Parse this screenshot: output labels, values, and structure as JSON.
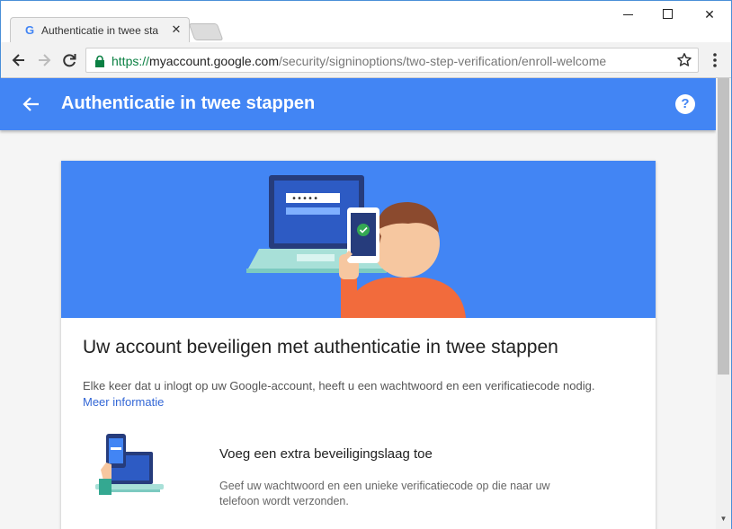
{
  "browser": {
    "tab_title": "Authenticatie in twee sta",
    "tab_favicon": "G",
    "close_glyph": "✕",
    "url_scheme": "https://",
    "url_host": "myaccount.google.com",
    "url_path": "/security/signinoptions/two-step-verification/enroll-welcome",
    "window_controls": [
      "minimize",
      "maximize",
      "close"
    ]
  },
  "appbar": {
    "title": "Authenticatie in twee stappen",
    "help_glyph": "?",
    "color": "#4285f4"
  },
  "card": {
    "heading": "Uw account beveiligen met authenticatie in twee stappen",
    "description": "Elke keer dat u inlogt op uw Google-account, heeft u een wachtwoord en een verificatiecode nodig.",
    "more_link": "Meer informatie",
    "feature": {
      "title": "Voeg een extra beveiligingslaag toe",
      "text": "Geef uw wachtwoord en een unieke verificatiecode op die naar uw telefoon wordt verzonden."
    }
  },
  "icons": {
    "back": "arrow-left-icon",
    "forward": "arrow-right-icon",
    "reload": "reload-icon",
    "lock": "lock-icon",
    "star": "star-icon",
    "menu": "more-vert-icon",
    "help": "help-icon"
  },
  "colors": {
    "accent": "#4285f4",
    "link": "#3367d6",
    "secure": "#0b8043"
  }
}
